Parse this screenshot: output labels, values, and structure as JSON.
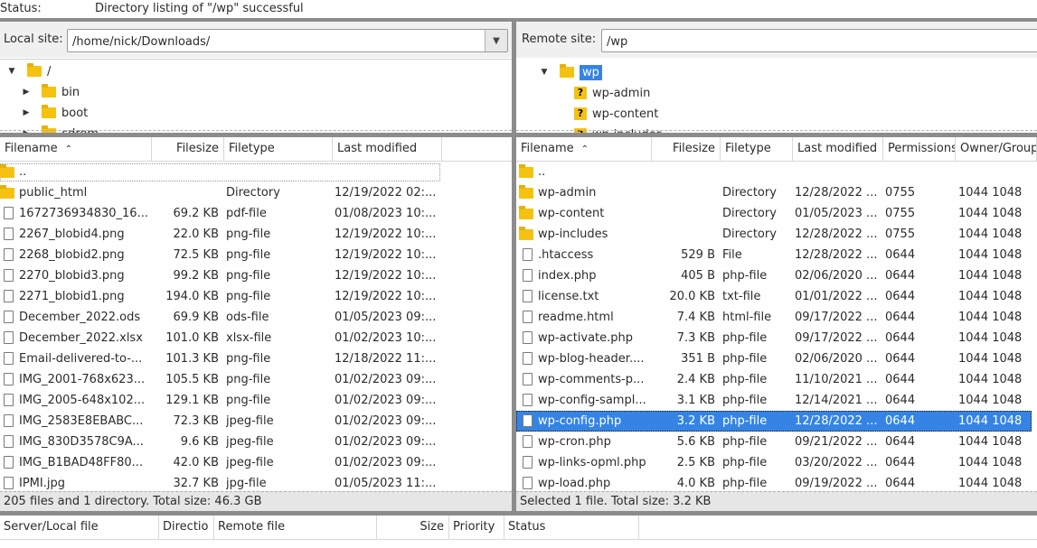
{
  "status_log": {
    "label": "Status:",
    "message": "Directory listing of \"/wp\" successful"
  },
  "local": {
    "site_label": "Local site:",
    "path": "/home/nick/Downloads/",
    "tree": [
      {
        "name": "/",
        "expanded": true
      },
      {
        "name": "bin"
      },
      {
        "name": "boot"
      },
      {
        "name": "cdrom"
      }
    ],
    "columns": [
      "Filename",
      "Filesize",
      "Filetype",
      "Last modified"
    ],
    "files": [
      {
        "name": "..",
        "size": "",
        "type": "",
        "modified": "",
        "kind": "parent"
      },
      {
        "name": "public_html",
        "size": "",
        "type": "Directory",
        "modified": "12/19/2022 02:...",
        "kind": "dir"
      },
      {
        "name": "1672736934830_16...",
        "size": "69.2 KB",
        "type": "pdf-file",
        "modified": "01/08/2023 10:...",
        "kind": "file"
      },
      {
        "name": "2267_blobid4.png",
        "size": "22.0 KB",
        "type": "png-file",
        "modified": "12/19/2022 10:...",
        "kind": "file"
      },
      {
        "name": "2268_blobid2.png",
        "size": "72.5 KB",
        "type": "png-file",
        "modified": "12/19/2022 10:...",
        "kind": "file"
      },
      {
        "name": "2270_blobid3.png",
        "size": "99.2 KB",
        "type": "png-file",
        "modified": "12/19/2022 10:...",
        "kind": "file"
      },
      {
        "name": "2271_blobid1.png",
        "size": "194.0 KB",
        "type": "png-file",
        "modified": "12/19/2022 10:...",
        "kind": "file"
      },
      {
        "name": "December_2022.ods",
        "size": "69.9 KB",
        "type": "ods-file",
        "modified": "01/05/2023 09:...",
        "kind": "file"
      },
      {
        "name": "December_2022.xlsx",
        "size": "101.0 KB",
        "type": "xlsx-file",
        "modified": "01/02/2023 10:...",
        "kind": "file"
      },
      {
        "name": "Email-delivered-to-...",
        "size": "101.3 KB",
        "type": "png-file",
        "modified": "12/18/2022 11:...",
        "kind": "file"
      },
      {
        "name": "IMG_2001-768x623...",
        "size": "105.5 KB",
        "type": "png-file",
        "modified": "01/02/2023 09:...",
        "kind": "file"
      },
      {
        "name": "IMG_2005-648x102...",
        "size": "129.1 KB",
        "type": "png-file",
        "modified": "01/02/2023 09:...",
        "kind": "file"
      },
      {
        "name": "IMG_2583E8EBABC...",
        "size": "72.3 KB",
        "type": "jpeg-file",
        "modified": "01/02/2023 09:...",
        "kind": "file"
      },
      {
        "name": "IMG_830D3578C9A...",
        "size": "9.6 KB",
        "type": "jpeg-file",
        "modified": "01/02/2023 09:...",
        "kind": "file"
      },
      {
        "name": "IMG_B1BAD48FF80...",
        "size": "42.0 KB",
        "type": "jpeg-file",
        "modified": "01/02/2023 09:...",
        "kind": "file"
      },
      {
        "name": "IPMI.jpg",
        "size": "32.7 KB",
        "type": "jpg-file",
        "modified": "01/05/2023 11:...",
        "kind": "file"
      }
    ],
    "status": "205 files and 1 directory. Total size: 46.3 GB"
  },
  "remote": {
    "site_label": "Remote site:",
    "path": "/wp",
    "tree": [
      {
        "name": "wp",
        "expanded": true,
        "selected": true
      },
      {
        "name": "wp-admin",
        "unknown": true
      },
      {
        "name": "wp-content",
        "unknown": true
      },
      {
        "name": "wp-includes",
        "unknown": true
      }
    ],
    "columns": [
      "Filename",
      "Filesize",
      "Filetype",
      "Last modified",
      "Permissions",
      "Owner/Group"
    ],
    "files": [
      {
        "name": "..",
        "size": "",
        "type": "",
        "modified": "",
        "perms": "",
        "owner": "",
        "kind": "parent"
      },
      {
        "name": "wp-admin",
        "size": "",
        "type": "Directory",
        "modified": "12/28/2022 ...",
        "perms": "0755",
        "owner": "1044 1048",
        "kind": "dir"
      },
      {
        "name": "wp-content",
        "size": "",
        "type": "Directory",
        "modified": "01/05/2023 ...",
        "perms": "0755",
        "owner": "1044 1048",
        "kind": "dir"
      },
      {
        "name": "wp-includes",
        "size": "",
        "type": "Directory",
        "modified": "12/28/2022 ...",
        "perms": "0755",
        "owner": "1044 1048",
        "kind": "dir"
      },
      {
        "name": ".htaccess",
        "size": "529 B",
        "type": "File",
        "modified": "12/28/2022 ...",
        "perms": "0644",
        "owner": "1044 1048",
        "kind": "file"
      },
      {
        "name": "index.php",
        "size": "405 B",
        "type": "php-file",
        "modified": "02/06/2020 ...",
        "perms": "0644",
        "owner": "1044 1048",
        "kind": "file"
      },
      {
        "name": "license.txt",
        "size": "20.0 KB",
        "type": "txt-file",
        "modified": "01/01/2022 ...",
        "perms": "0644",
        "owner": "1044 1048",
        "kind": "file"
      },
      {
        "name": "readme.html",
        "size": "7.4 KB",
        "type": "html-file",
        "modified": "09/17/2022 ...",
        "perms": "0644",
        "owner": "1044 1048",
        "kind": "file"
      },
      {
        "name": "wp-activate.php",
        "size": "7.3 KB",
        "type": "php-file",
        "modified": "09/17/2022 ...",
        "perms": "0644",
        "owner": "1044 1048",
        "kind": "file"
      },
      {
        "name": "wp-blog-header....",
        "size": "351 B",
        "type": "php-file",
        "modified": "02/06/2020 ...",
        "perms": "0644",
        "owner": "1044 1048",
        "kind": "file"
      },
      {
        "name": "wp-comments-p...",
        "size": "2.4 KB",
        "type": "php-file",
        "modified": "11/10/2021 ...",
        "perms": "0644",
        "owner": "1044 1048",
        "kind": "file"
      },
      {
        "name": "wp-config-sampl...",
        "size": "3.1 KB",
        "type": "php-file",
        "modified": "12/14/2021 ...",
        "perms": "0644",
        "owner": "1044 1048",
        "kind": "file"
      },
      {
        "name": "wp-config.php",
        "size": "3.2 KB",
        "type": "php-file",
        "modified": "12/28/2022 ...",
        "perms": "0644",
        "owner": "1044 1048",
        "kind": "file",
        "selected": true
      },
      {
        "name": "wp-cron.php",
        "size": "5.6 KB",
        "type": "php-file",
        "modified": "09/21/2022 ...",
        "perms": "0644",
        "owner": "1044 1048",
        "kind": "file"
      },
      {
        "name": "wp-links-opml.php",
        "size": "2.5 KB",
        "type": "php-file",
        "modified": "03/20/2022 ...",
        "perms": "0644",
        "owner": "1044 1048",
        "kind": "file"
      },
      {
        "name": "wp-load.php",
        "size": "4.0 KB",
        "type": "php-file",
        "modified": "09/19/2022 ...",
        "perms": "0644",
        "owner": "1044 1048",
        "kind": "file"
      }
    ],
    "status": "Selected 1 file. Total size: 3.2 KB"
  },
  "queue": {
    "columns": [
      "Server/Local file",
      "Directio",
      "Remote file",
      "Size",
      "Priority",
      "Status"
    ]
  },
  "colors": {
    "selection": "#3584e4",
    "folder": "#f5c211",
    "divider": "#8c8c8c"
  }
}
